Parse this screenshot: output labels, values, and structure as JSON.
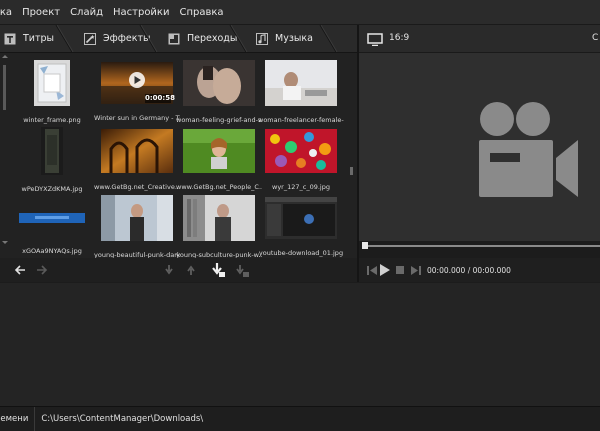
{
  "menu": [
    "вка",
    "Проект",
    "Слайд",
    "Настройки",
    "Справка"
  ],
  "tabs": [
    {
      "label": "Титры",
      "icon": "text-icon"
    },
    {
      "label": "Эффекты",
      "icon": "magic-wand-icon"
    },
    {
      "label": "Переходы",
      "icon": "transition-icon"
    },
    {
      "label": "Музыка",
      "icon": "music-note-icon"
    }
  ],
  "media": [
    {
      "name": "winter_frame.png"
    },
    {
      "name": "Winter sun in Germany - Ti...",
      "duration": "0:00:58"
    },
    {
      "name": "woman-feeling-grief-and-s..."
    },
    {
      "name": "woman-freelancer-female-..."
    },
    {
      "name": "wPeDYXZdKMA.jpg"
    },
    {
      "name": "www.GetBg.net_Creative..."
    },
    {
      "name": "www.GetBg.net_People_C..."
    },
    {
      "name": "wyr_127_c_09.jpg"
    },
    {
      "name": "xGOAa9NYAQs.jpg"
    },
    {
      "name": "young-beautiful-punk-dark..."
    },
    {
      "name": "young-subculture-punk-w..."
    },
    {
      "name": "youtube-download_01.jpg"
    }
  ],
  "preview": {
    "aspect": "16:9",
    "corner_text": "С",
    "timecode": "00:00.000 / 00:00.000"
  },
  "status": {
    "label": "времени",
    "path": "C:\\Users\\ContentManager\\Downloads\\"
  }
}
